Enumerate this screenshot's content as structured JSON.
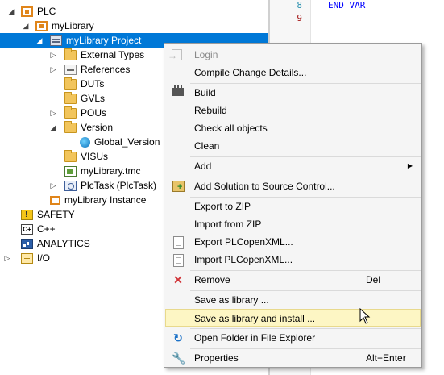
{
  "tree": {
    "items": [
      {
        "label": "PLC",
        "icon": "plc-icon",
        "arrow": "◢"
      },
      {
        "label": "myLibrary",
        "icon": "plc-project-icon",
        "arrow": "◢"
      },
      {
        "label": "myLibrary Project",
        "icon": "project-icon",
        "arrow": "◢",
        "selected": true
      },
      {
        "label": "External Types",
        "icon": "folder-icon",
        "arrow": "▷"
      },
      {
        "label": "References",
        "icon": "references-icon",
        "arrow": "▷"
      },
      {
        "label": "DUTs",
        "icon": "folder-icon",
        "arrow": ""
      },
      {
        "label": "GVLs",
        "icon": "folder-icon",
        "arrow": ""
      },
      {
        "label": "POUs",
        "icon": "folder-icon",
        "arrow": "▷"
      },
      {
        "label": "Version",
        "icon": "folder-icon",
        "arrow": "◢"
      },
      {
        "label": "Global_Version",
        "icon": "globe-icon",
        "arrow": ""
      },
      {
        "label": "VISUs",
        "icon": "folder-icon",
        "arrow": ""
      },
      {
        "label": "myLibrary.tmc",
        "icon": "tmc-file-icon",
        "arrow": ""
      },
      {
        "label": "PlcTask (PlcTask)",
        "icon": "task-icon",
        "arrow": "▷"
      },
      {
        "label": "myLibrary Instance",
        "icon": "instance-icon",
        "arrow": ""
      },
      {
        "label": "SAFETY",
        "icon": "safety-icon",
        "arrow": ""
      },
      {
        "label": "C++",
        "icon": "cpp-icon",
        "arrow": ""
      },
      {
        "label": "ANALYTICS",
        "icon": "analytics-icon",
        "arrow": ""
      },
      {
        "label": "I/O",
        "icon": "io-icon",
        "arrow": "▷"
      }
    ]
  },
  "editor": {
    "line_numbers": [
      "8",
      "9"
    ],
    "code_lines": [
      "END_VAR",
      ""
    ]
  },
  "context_menu": {
    "items": [
      {
        "label": "Login",
        "shortcut": "",
        "disabled": true,
        "icon": "login-icon"
      },
      {
        "label": "Compile Change Details...",
        "shortcut": "",
        "disabled": false,
        "icon": ""
      },
      {
        "label": "Build",
        "shortcut": "",
        "disabled": false,
        "icon": "build-icon"
      },
      {
        "label": "Rebuild",
        "shortcut": "",
        "disabled": false,
        "icon": ""
      },
      {
        "label": "Check all objects",
        "shortcut": "",
        "disabled": false,
        "icon": ""
      },
      {
        "label": "Clean",
        "shortcut": "",
        "disabled": false,
        "icon": ""
      },
      {
        "label": "Add",
        "shortcut": "",
        "disabled": false,
        "icon": "",
        "submenu": "▶"
      },
      {
        "label": "Add Solution to Source Control...",
        "shortcut": "",
        "disabled": false,
        "icon": "source-control-icon"
      },
      {
        "label": "Export to ZIP",
        "shortcut": "",
        "disabled": false,
        "icon": ""
      },
      {
        "label": "Import from ZIP",
        "shortcut": "",
        "disabled": false,
        "icon": ""
      },
      {
        "label": "Export PLCopenXML...",
        "shortcut": "",
        "disabled": false,
        "icon": "xml-export-icon"
      },
      {
        "label": "Import PLCopenXML...",
        "shortcut": "",
        "disabled": false,
        "icon": "xml-import-icon"
      },
      {
        "label": "Remove",
        "shortcut": "Del",
        "disabled": false,
        "icon": "remove-icon"
      },
      {
        "label": "Save as library ...",
        "shortcut": "",
        "disabled": false,
        "icon": ""
      },
      {
        "label": "Save as library and install ...",
        "shortcut": "",
        "disabled": false,
        "icon": "",
        "highlighted": true
      },
      {
        "label": "Open Folder in File Explorer",
        "shortcut": "",
        "disabled": false,
        "icon": "open-folder-icon"
      },
      {
        "label": "Properties",
        "shortcut": "Alt+Enter",
        "disabled": false,
        "icon": "wrench-icon"
      }
    ]
  },
  "colors": {
    "selection": "#0078d7",
    "menu_background": "#f5f5f5",
    "menu_highlight": "#fdf6c4",
    "remove_icon": "#d13438"
  }
}
